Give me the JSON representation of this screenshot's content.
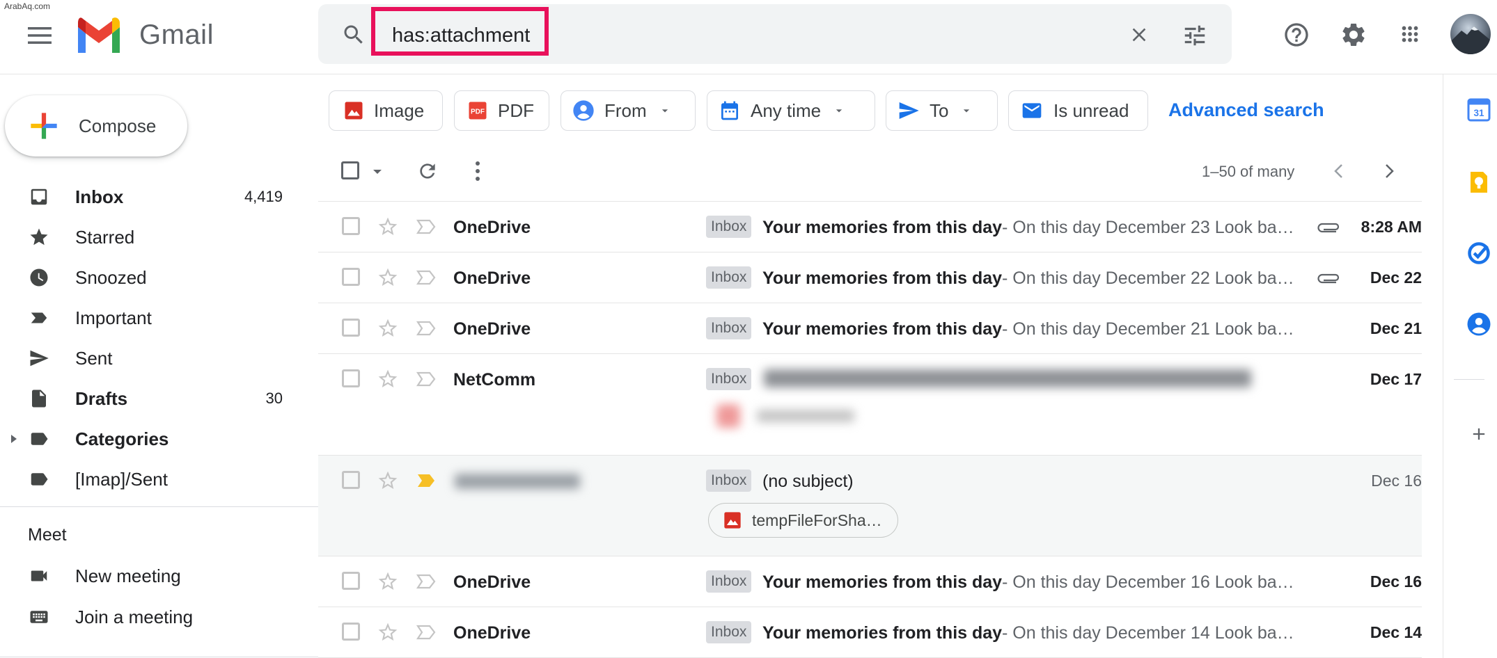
{
  "watermark": "ArabAq.com",
  "app": {
    "name": "Gmail"
  },
  "search": {
    "value": "has:attachment"
  },
  "compose": {
    "label": "Compose"
  },
  "nav": [
    {
      "id": "inbox",
      "label": "Inbox",
      "count": "4,419",
      "bold": true
    },
    {
      "id": "starred",
      "label": "Starred",
      "count": ""
    },
    {
      "id": "snoozed",
      "label": "Snoozed",
      "count": ""
    },
    {
      "id": "important",
      "label": "Important",
      "count": ""
    },
    {
      "id": "sent",
      "label": "Sent",
      "count": ""
    },
    {
      "id": "drafts",
      "label": "Drafts",
      "count": "30",
      "bold": true
    },
    {
      "id": "categories",
      "label": "Categories",
      "count": "",
      "bold": true
    },
    {
      "id": "imap-sent",
      "label": "[Imap]/Sent",
      "count": ""
    }
  ],
  "meet": {
    "title": "Meet",
    "new_meeting": "New meeting",
    "join_meeting": "Join a meeting"
  },
  "chips": {
    "image": "Image",
    "pdf": "PDF",
    "from": "From",
    "any_time": "Any time",
    "to": "To",
    "is_unread": "Is unread",
    "advanced": "Advanced search"
  },
  "toolbar": {
    "pager": "1–50 of many"
  },
  "emails": [
    {
      "sender": "OneDrive",
      "label": "Inbox",
      "subject": "Your memories from this day",
      "snippet": " - On this day December 23 Look ba…",
      "date": "8:28 AM",
      "attachment": true
    },
    {
      "sender": "OneDrive",
      "label": "Inbox",
      "subject": "Your memories from this day",
      "snippet": " - On this day December 22 Look ba…",
      "date": "Dec 22",
      "attachment": true
    },
    {
      "sender": "OneDrive",
      "label": "Inbox",
      "subject": "Your memories from this day",
      "snippet": " - On this day December 21 Look ba…",
      "date": "Dec 21",
      "attachment": false
    },
    {
      "sender": "NetComm",
      "label": "Inbox",
      "subject": "",
      "snippet": "",
      "date": "Dec 17",
      "attachment": false
    },
    {
      "sender": "",
      "label": "Inbox",
      "subject": "(no subject)",
      "snippet": "",
      "date": "Dec 16",
      "attachment_name": "tempFileForSha…"
    },
    {
      "sender": "OneDrive",
      "label": "Inbox",
      "subject": "Your memories from this day",
      "snippet": " - On this day December 16 Look ba…",
      "date": "Dec 16",
      "attachment": false
    },
    {
      "sender": "OneDrive",
      "label": "Inbox",
      "subject": "Your memories from this day",
      "snippet": " - On this day December 14 Look ba…",
      "date": "Dec 14",
      "attachment": false
    }
  ],
  "colors": {
    "accent_blue": "#1a73e8",
    "highlight_border": "#e8115b",
    "important_yellow": "#f6bf26"
  }
}
